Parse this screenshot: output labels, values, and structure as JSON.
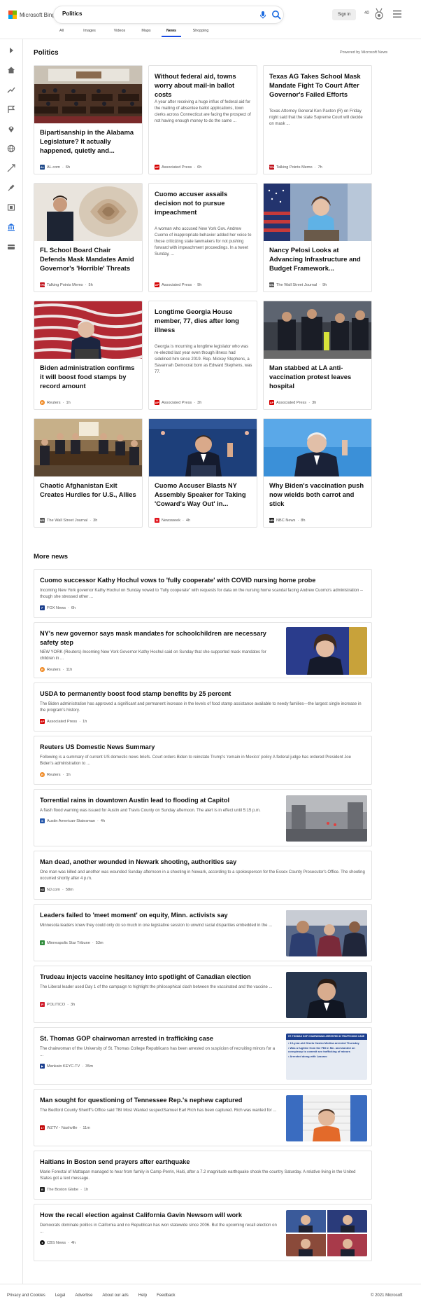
{
  "app": {
    "logo_text": "Microsoft Bing"
  },
  "search": {
    "value": "Politics"
  },
  "header": {
    "signin_label": "Sign in",
    "points": "40"
  },
  "tabs": [
    "All",
    "Images",
    "Videos",
    "Maps",
    "News",
    "Shopping"
  ],
  "active_tab": "News",
  "section": {
    "title": "Politics",
    "powered_by": "Powered by Microsoft News"
  },
  "cards": [
    {
      "title": "Bipartisanship in the Alabama Legislature? It actually happened, quietly and...",
      "source": "AL.com",
      "time": "6h",
      "image": "legislature-chamber-photo",
      "logo_color": "#1f4a8a",
      "logo_text": "AL"
    },
    {
      "title": "Without federal aid, towns worry about mail-in ballot costs",
      "desc": "A year after receiving a huge influx of federal aid for the mailing of absentee ballot applications, town clerks across Connecticut are facing the prospect of not having enough money to do the same ...",
      "source": "Associated Press",
      "time": "6h",
      "logo_color": "#d40000",
      "logo_text": "AP"
    },
    {
      "title": "Texas AG Takes School Mask Mandate Fight To Court After Governor's Failed Efforts",
      "desc": "Texas Attorney General Ken Paxton (R) on Friday night said that the state Supreme Court will decide on mask ...",
      "source": "Talking Points Memo",
      "time": "7h",
      "logo_color": "#c0121b",
      "logo_text": "TPM"
    },
    {
      "title": "FL School Board Chair Defends Mask Mandates Amid Governor's 'Horrible' Threats",
      "source": "Talking Points Memo",
      "time": "5h",
      "image": "governor-shell-photo",
      "logo_color": "#c0121b",
      "logo_text": "TPM"
    },
    {
      "title": "Cuomo accuser assails decision not to pursue impeachment",
      "desc": "A woman who accused New York Gov. Andrew Cuomo of inappropriate behavior added her voice to those criticizing state lawmakers for not pushing forward with impeachment proceedings. In a tweet Sunday, ...",
      "source": "Associated Press",
      "time": "9h",
      "logo_color": "#d40000",
      "logo_text": "AP"
    },
    {
      "title": "Nancy Pelosi Looks at Advancing Infrastructure and Budget Framework...",
      "source": "The Wall Street Journal",
      "time": "9h",
      "image": "pelosi-podium-photo",
      "logo_color": "#555555",
      "logo_text": "WSJ"
    },
    {
      "title": "Biden administration confirms it will boost food stamps by record amount",
      "source": "Reuters",
      "time": "1h",
      "image": "biden-flags-photo",
      "logo_color": "#f08a24",
      "logo_text": "R"
    },
    {
      "title": "Longtime Georgia House member, 77, dies after long illness",
      "desc": "Georgia is mourning a longtime legislator who was re-elected last year even though illness had sidelined him since 2019. Rep. Mickey Stephens, a Savannah Democrat born as Edward Stephens, was 77.",
      "source": "Associated Press",
      "time": "3h",
      "logo_color": "#d40000",
      "logo_text": "AP"
    },
    {
      "title": "Man stabbed at LA anti-vaccination protest leaves hospital",
      "source": "Associated Press",
      "time": "3h",
      "image": "police-protest-photo",
      "logo_color": "#d40000",
      "logo_text": "AP"
    },
    {
      "title": "Chaotic Afghanistan Exit Creates Hurdles for U.S., Allies",
      "source": "The Wall Street Journal",
      "time": "3h",
      "image": "situation-room-photo",
      "logo_color": "#555555",
      "logo_text": "WSJ"
    },
    {
      "title": "Cuomo Accuser Blasts NY Assembly Speaker for Taking 'Coward's Way Out' in...",
      "source": "Newsweek",
      "time": "4h",
      "image": "cuomo-podium-photo",
      "logo_color": "#e0161e",
      "logo_text": "N"
    },
    {
      "title": "Why Biden's vaccination push now wields both carrot and stick",
      "source": "NBC News",
      "time": "8h",
      "image": "biden-speaking-photo",
      "logo_color": "#222222",
      "logo_text": "NBC"
    }
  ],
  "more_news": {
    "title": "More news",
    "items": [
      {
        "title": "Cuomo successor Kathy Hochul vows to 'fully cooperate' with COVID nursing home probe",
        "desc": "Incoming New York governor Kathy Hochul on Sunday vowed to \"fully cooperate\" with requests for data on the nursing home scandal facing Andrew Cuomo's administration -- though she stressed other ...",
        "source": "FOX News",
        "time": "6h",
        "logo_color": "#1a3e8c",
        "logo_text": "F"
      },
      {
        "title": "NY's new governor says mask mandates for schoolchildren are necessary safety step",
        "desc": "NEW YORK (Reuters)-Incoming New York Governor Kathy Hochul said on Sunday that she supported mask mandates for children in ...",
        "source": "Reuters",
        "time": "11h",
        "image": "hochul-photo",
        "logo_color": "#f08a24",
        "logo_text": "R"
      },
      {
        "title": "USDA to permanently boost food stamp benefits by 25 percent",
        "desc": "The Biden administration has approved a significant and permanent increase in the levels of food stamp assistance available to needy families—the largest single increase in the program's history.",
        "source": "Associated Press",
        "time": "1h",
        "logo_color": "#d40000",
        "logo_text": "AP"
      },
      {
        "title": "Reuters US Domestic News Summary",
        "desc": "Following is a summary of current US domestic news briefs. Court orders Biden to reinstate Trump's 'remain in Mexico' policy A federal judge has ordered President Joe Biden's administration to ...",
        "source": "Reuters",
        "time": "1h",
        "logo_color": "#f08a24",
        "logo_text": "R"
      },
      {
        "title": "Torrential rains in downtown Austin lead to flooding at Capitol",
        "desc": "A flash flood warning was issued for Austin and Travis County on Sunday afternoon. The alert is in effect until 5:15 p.m.",
        "source": "Austin American-Statesman",
        "time": "4h",
        "image": "rain-street-photo",
        "logo_color": "#2255aa",
        "logo_text": "S"
      },
      {
        "title": "Man dead, another wounded in Newark shooting, authorities say",
        "desc": "One man was killed and another was wounded Sunday afternoon in a shooting in Newark, according to a spokesperson for the Essex County Prosecutor's Office. The shooting occurred shortly after 4 p.m.",
        "source": "NJ.com",
        "time": "58m",
        "logo_color": "#333333",
        "logo_text": "NJ"
      },
      {
        "title": "Leaders failed to 'meet moment' on equity, Minn. activists say",
        "desc": "Minnesota leaders knew they could only do so much in one legislative session to unwind racial disparities embedded in the ...",
        "source": "Minneapolis Star Tribune",
        "time": "53m",
        "image": "activists-photo",
        "logo_color": "#2e8b3a",
        "logo_text": "★"
      },
      {
        "title": "Trudeau injects vaccine hesitancy into spotlight of Canadian election",
        "desc": "The Liberal leader used Day 1 of the campaign to highlight the philosophical clash between the vaccinated and the vaccine ...",
        "source": "POLITICO",
        "time": "3h",
        "image": "trudeau-photo",
        "logo_color": "#d01f2e",
        "logo_text": "P"
      },
      {
        "title": "St. Thomas GOP chairwoman arrested in trafficking case",
        "desc": "The chairwoman of the University of St. Thomas College Republicans has been arrested on suspicion of recruiting minors for a ...",
        "source": "Mankato KEYC-TV",
        "time": "35m",
        "image": "news-graphic",
        "logo_color": "#1c3f8f",
        "logo_text": "▶",
        "graphic": {
          "heading": "ST. THOMAS GOP CHAIRWOMAN ARRESTED IN TRAFFICKING CASE",
          "bullets": [
            "19-year-old Gisela Castro Medina arrested Thursday",
            "Was a fugitive from the FBI in Mn. and wanted on conspiracy to commit sex trafficking of minors",
            "Arrested along with Lazzaro"
          ]
        }
      },
      {
        "title": "Man sought for questioning of Tennessee Rep.'s nephew captured",
        "desc": "The Bedford County Sheriff's Office said TBI Most Wanted suspectSamuel Earl Rich has been captured. Rich was wanted for ...",
        "source": "WZTV - Nashville",
        "time": "11m",
        "image": "mugshot-photo",
        "logo_color": "#c00000",
        "logo_text": "17"
      },
      {
        "title": "Haitians in Boston send prayers after earthquake",
        "desc": "Marie Forestal of Mattapan managed to hear from family in Camp-Perrin, Haiti, after a 7.2 magnitude earthquake shook the country Saturday. A relative living in the United States got a text message.",
        "source": "The Boston Globe",
        "time": "1h",
        "logo_color": "#222222",
        "logo_text": "B"
      },
      {
        "title": "How the recall election against California Gavin Newsom will work",
        "desc": "Democrats dominate politics in California and no Republican has won statewide since 2006. But the upcoming recall election on ...",
        "source": "CBS News",
        "time": "4h",
        "image": "collage-photo",
        "logo_color": "#111111",
        "logo_text": "●"
      }
    ]
  },
  "footer": {
    "links": [
      "Privacy and Cookies",
      "Legal",
      "Advertise",
      "About our ads",
      "Help",
      "Feedback"
    ],
    "copyright": "© 2021 Microsoft"
  },
  "colors": {
    "accent": "#174ae4",
    "bing_blue": "#1d6ce0"
  }
}
